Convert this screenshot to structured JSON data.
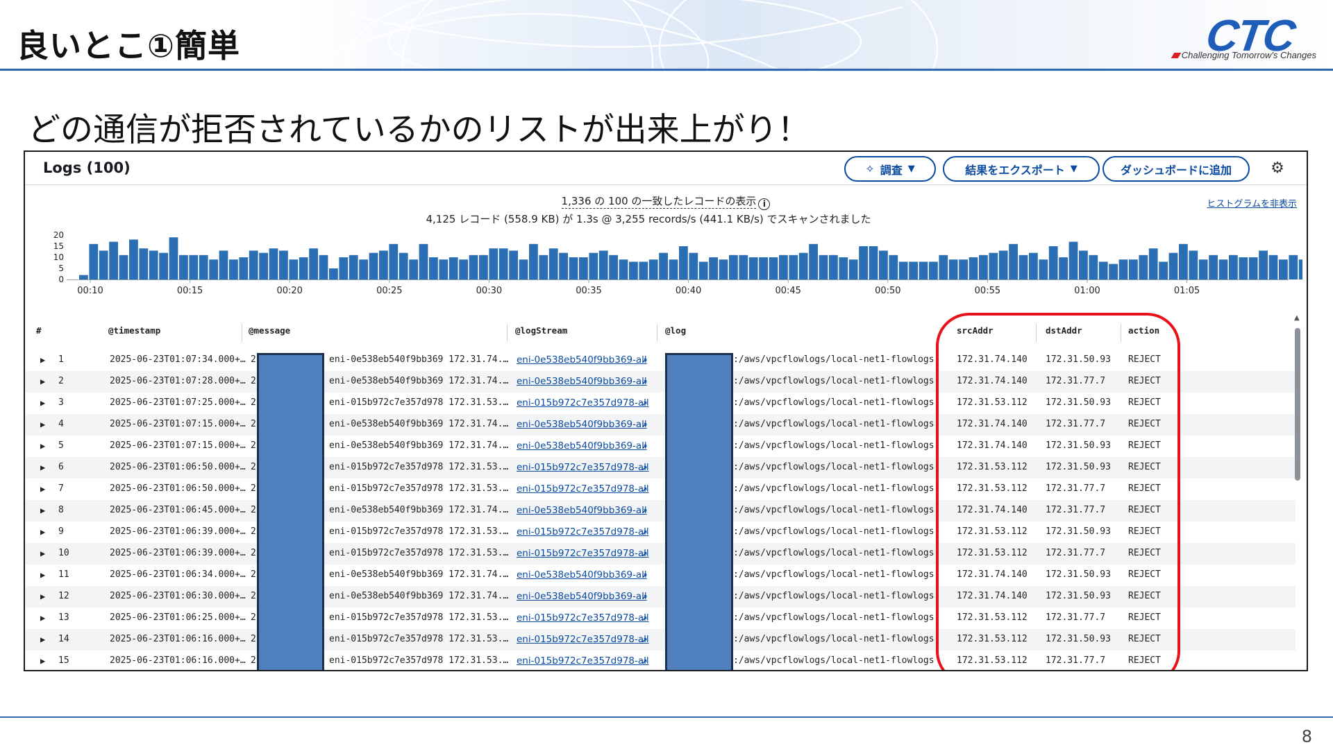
{
  "slide": {
    "title": "良いとこ①簡単",
    "subtitle": "どの通信が拒否されているかのリストが出来上がり！",
    "page_number": "8"
  },
  "logo": {
    "text": "CTC",
    "tagline": "Challenging Tomorrow's Changes",
    "color": "#1f5eb8"
  },
  "panel": {
    "title": "Logs (100)",
    "buttons": {
      "investigate": "調査",
      "export": "結果をエクスポート",
      "dashboard": "ダッシュボードに追加"
    },
    "summary_line1": "1,336 の 100 の一致したレコードの表示",
    "summary_line2": "4,125 レコード (558.9 KB) が 1.3s @ 3,255 records/s (441.1 KB/s) でスキャンされました",
    "hide_histogram": "ヒストグラムを非表示",
    "accent_color": "#0a4a9f"
  },
  "chart_data": {
    "type": "bar",
    "y_ticks": [
      "20",
      "15",
      "10",
      "5",
      "0"
    ],
    "ylim": [
      0,
      20
    ],
    "x_ticks": [
      "00:10",
      "00:15",
      "00:20",
      "00:25",
      "00:30",
      "00:35",
      "00:40",
      "00:45",
      "00:50",
      "00:55",
      "01:00",
      "01:05"
    ],
    "values": [
      2,
      16,
      13,
      17,
      11,
      18,
      14,
      13,
      12,
      19,
      11,
      11,
      11,
      9,
      13,
      9,
      10,
      13,
      12,
      14,
      13,
      9,
      10,
      14,
      11,
      5,
      10,
      11,
      9,
      12,
      13,
      16,
      12,
      9,
      16,
      10,
      9,
      10,
      9,
      11,
      11,
      14,
      14,
      13,
      9,
      16,
      11,
      14,
      12,
      10,
      10,
      12,
      13,
      11,
      9,
      8,
      8,
      9,
      12,
      9,
      15,
      12,
      8,
      10,
      9,
      11,
      11,
      10,
      10,
      10,
      11,
      11,
      12,
      16,
      11,
      11,
      10,
      9,
      15,
      15,
      13,
      11,
      8,
      8,
      8,
      8,
      11,
      9,
      9,
      10,
      11,
      12,
      13,
      16,
      11,
      12,
      9,
      15,
      10,
      17,
      13,
      11,
      8,
      7,
      9,
      9,
      11,
      14,
      8,
      12,
      16,
      13,
      9,
      11,
      9,
      11,
      10,
      10,
      13,
      11,
      9,
      11,
      9,
      10,
      8,
      10,
      13,
      11,
      7,
      2
    ],
    "color": "#2a6fb3"
  },
  "table": {
    "columns": [
      "#",
      "@timestamp",
      "@message",
      "@logStream",
      "@log",
      "srcAddr",
      "dstAddr",
      "action"
    ],
    "rows": [
      {
        "num": "1",
        "ts": "2025-06-23T01:07:34.000+…",
        "msg2": "2",
        "msgtail": "eni-0e538eb540f9bb369 172.31.74.…",
        "stream": "eni-0e538eb540f9bb369-all",
        "log": ":/aws/vpcflowlogs/local-net1-flowlogs",
        "src": "172.31.74.140",
        "dst": "172.31.50.93",
        "action": "REJECT"
      },
      {
        "num": "2",
        "ts": "2025-06-23T01:07:28.000+…",
        "msg2": "2",
        "msgtail": "eni-0e538eb540f9bb369 172.31.74.…",
        "stream": "eni-0e538eb540f9bb369-all",
        "log": ":/aws/vpcflowlogs/local-net1-flowlogs",
        "src": "172.31.74.140",
        "dst": "172.31.77.7",
        "action": "REJECT"
      },
      {
        "num": "3",
        "ts": "2025-06-23T01:07:25.000+…",
        "msg2": "2",
        "msgtail": "eni-015b972c7e357d978 172.31.53.…",
        "stream": "eni-015b972c7e357d978-all",
        "log": ":/aws/vpcflowlogs/local-net1-flowlogs",
        "src": "172.31.53.112",
        "dst": "172.31.50.93",
        "action": "REJECT"
      },
      {
        "num": "4",
        "ts": "2025-06-23T01:07:15.000+…",
        "msg2": "2",
        "msgtail": "eni-0e538eb540f9bb369 172.31.74.…",
        "stream": "eni-0e538eb540f9bb369-all",
        "log": ":/aws/vpcflowlogs/local-net1-flowlogs",
        "src": "172.31.74.140",
        "dst": "172.31.77.7",
        "action": "REJECT"
      },
      {
        "num": "5",
        "ts": "2025-06-23T01:07:15.000+…",
        "msg2": "2",
        "msgtail": "eni-0e538eb540f9bb369 172.31.74.…",
        "stream": "eni-0e538eb540f9bb369-all",
        "log": ":/aws/vpcflowlogs/local-net1-flowlogs",
        "src": "172.31.74.140",
        "dst": "172.31.50.93",
        "action": "REJECT"
      },
      {
        "num": "6",
        "ts": "2025-06-23T01:06:50.000+…",
        "msg2": "2",
        "msgtail": "eni-015b972c7e357d978 172.31.53.…",
        "stream": "eni-015b972c7e357d978-all",
        "log": ":/aws/vpcflowlogs/local-net1-flowlogs",
        "src": "172.31.53.112",
        "dst": "172.31.50.93",
        "action": "REJECT"
      },
      {
        "num": "7",
        "ts": "2025-06-23T01:06:50.000+…",
        "msg2": "2",
        "msgtail": "eni-015b972c7e357d978 172.31.53.…",
        "stream": "eni-015b972c7e357d978-all",
        "log": ":/aws/vpcflowlogs/local-net1-flowlogs",
        "src": "172.31.53.112",
        "dst": "172.31.77.7",
        "action": "REJECT"
      },
      {
        "num": "8",
        "ts": "2025-06-23T01:06:45.000+…",
        "msg2": "2",
        "msgtail": "eni-0e538eb540f9bb369 172.31.74.…",
        "stream": "eni-0e538eb540f9bb369-all",
        "log": ":/aws/vpcflowlogs/local-net1-flowlogs",
        "src": "172.31.74.140",
        "dst": "172.31.77.7",
        "action": "REJECT"
      },
      {
        "num": "9",
        "ts": "2025-06-23T01:06:39.000+…",
        "msg2": "2",
        "msgtail": "eni-015b972c7e357d978 172.31.53.…",
        "stream": "eni-015b972c7e357d978-all",
        "log": ":/aws/vpcflowlogs/local-net1-flowlogs",
        "src": "172.31.53.112",
        "dst": "172.31.50.93",
        "action": "REJECT"
      },
      {
        "num": "10",
        "ts": "2025-06-23T01:06:39.000+…",
        "msg2": "2",
        "msgtail": "eni-015b972c7e357d978 172.31.53.…",
        "stream": "eni-015b972c7e357d978-all",
        "log": ":/aws/vpcflowlogs/local-net1-flowlogs",
        "src": "172.31.53.112",
        "dst": "172.31.77.7",
        "action": "REJECT"
      },
      {
        "num": "11",
        "ts": "2025-06-23T01:06:34.000+…",
        "msg2": "2",
        "msgtail": "eni-0e538eb540f9bb369 172.31.74.…",
        "stream": "eni-0e538eb540f9bb369-all",
        "log": ":/aws/vpcflowlogs/local-net1-flowlogs",
        "src": "172.31.74.140",
        "dst": "172.31.50.93",
        "action": "REJECT"
      },
      {
        "num": "12",
        "ts": "2025-06-23T01:06:30.000+…",
        "msg2": "2",
        "msgtail": "eni-0e538eb540f9bb369 172.31.74.…",
        "stream": "eni-0e538eb540f9bb369-all",
        "log": ":/aws/vpcflowlogs/local-net1-flowlogs",
        "src": "172.31.74.140",
        "dst": "172.31.50.93",
        "action": "REJECT"
      },
      {
        "num": "13",
        "ts": "2025-06-23T01:06:25.000+…",
        "msg2": "2",
        "msgtail": "eni-015b972c7e357d978 172.31.53.…",
        "stream": "eni-015b972c7e357d978-all",
        "log": ":/aws/vpcflowlogs/local-net1-flowlogs",
        "src": "172.31.53.112",
        "dst": "172.31.77.7",
        "action": "REJECT"
      },
      {
        "num": "14",
        "ts": "2025-06-23T01:06:16.000+…",
        "msg2": "2",
        "msgtail": "eni-015b972c7e357d978 172.31.53.…",
        "stream": "eni-015b972c7e357d978-all",
        "log": ":/aws/vpcflowlogs/local-net1-flowlogs",
        "src": "172.31.53.112",
        "dst": "172.31.50.93",
        "action": "REJECT"
      },
      {
        "num": "15",
        "ts": "2025-06-23T01:06:16.000+…",
        "msg2": "2",
        "msgtail": "eni-015b972c7e357d978 172.31.53.…",
        "stream": "eni-015b972c7e357d978-all",
        "log": ":/aws/vpcflowlogs/local-net1-flowlogs",
        "src": "172.31.53.112",
        "dst": "172.31.77.7",
        "action": "REJECT"
      }
    ]
  },
  "redaction_color": "#4f80bd",
  "highlight_color": "#e8101a"
}
